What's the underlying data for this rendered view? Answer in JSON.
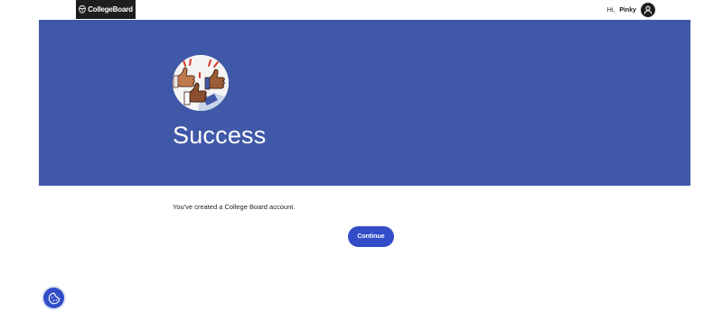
{
  "header": {
    "logo_text": "CollegeBoard",
    "greeting": "Hi,",
    "user_name": "Pinky",
    "icons": {
      "logo": "acorn-icon",
      "avatar": "user-avatar-icon"
    }
  },
  "hero": {
    "title": "Success",
    "illustration": "thumbs-up-illustration",
    "background_color": "#4058a8"
  },
  "main": {
    "message": "You've created a College Board account.",
    "continue_label": "Continue"
  },
  "footer": {
    "cookie_settings_icon": "cookie-icon"
  },
  "colors": {
    "accent": "#324dc7",
    "hero": "#4058a8",
    "text": "#1e1e1e"
  }
}
